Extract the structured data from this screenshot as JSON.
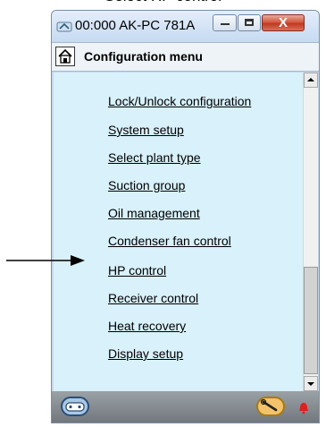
{
  "top_caption": "Select HP control",
  "window": {
    "title": "00:000 AK-PC 781A",
    "min_label": "—",
    "max_label": "□",
    "close_label": "X"
  },
  "header": {
    "title": "Configuration menu"
  },
  "menu": {
    "items": [
      {
        "label": "Lock/Unlock configuration"
      },
      {
        "label": "System setup"
      },
      {
        "label": "Select plant type"
      },
      {
        "label": "Suction group"
      },
      {
        "label": "Oil management"
      },
      {
        "label": "Condenser fan control"
      },
      {
        "label": "HP control"
      },
      {
        "label": "Receiver control"
      },
      {
        "label": "Heat recovery"
      },
      {
        "label": "Display setup"
      }
    ]
  },
  "footer": {
    "left_icon": "controller-icon",
    "right_icon": "wrench-icon",
    "alarm_icon": "bell-icon",
    "alarm_color": "#e0201b"
  },
  "annotation": {
    "arrow_icon": "arrow-right-icon"
  }
}
